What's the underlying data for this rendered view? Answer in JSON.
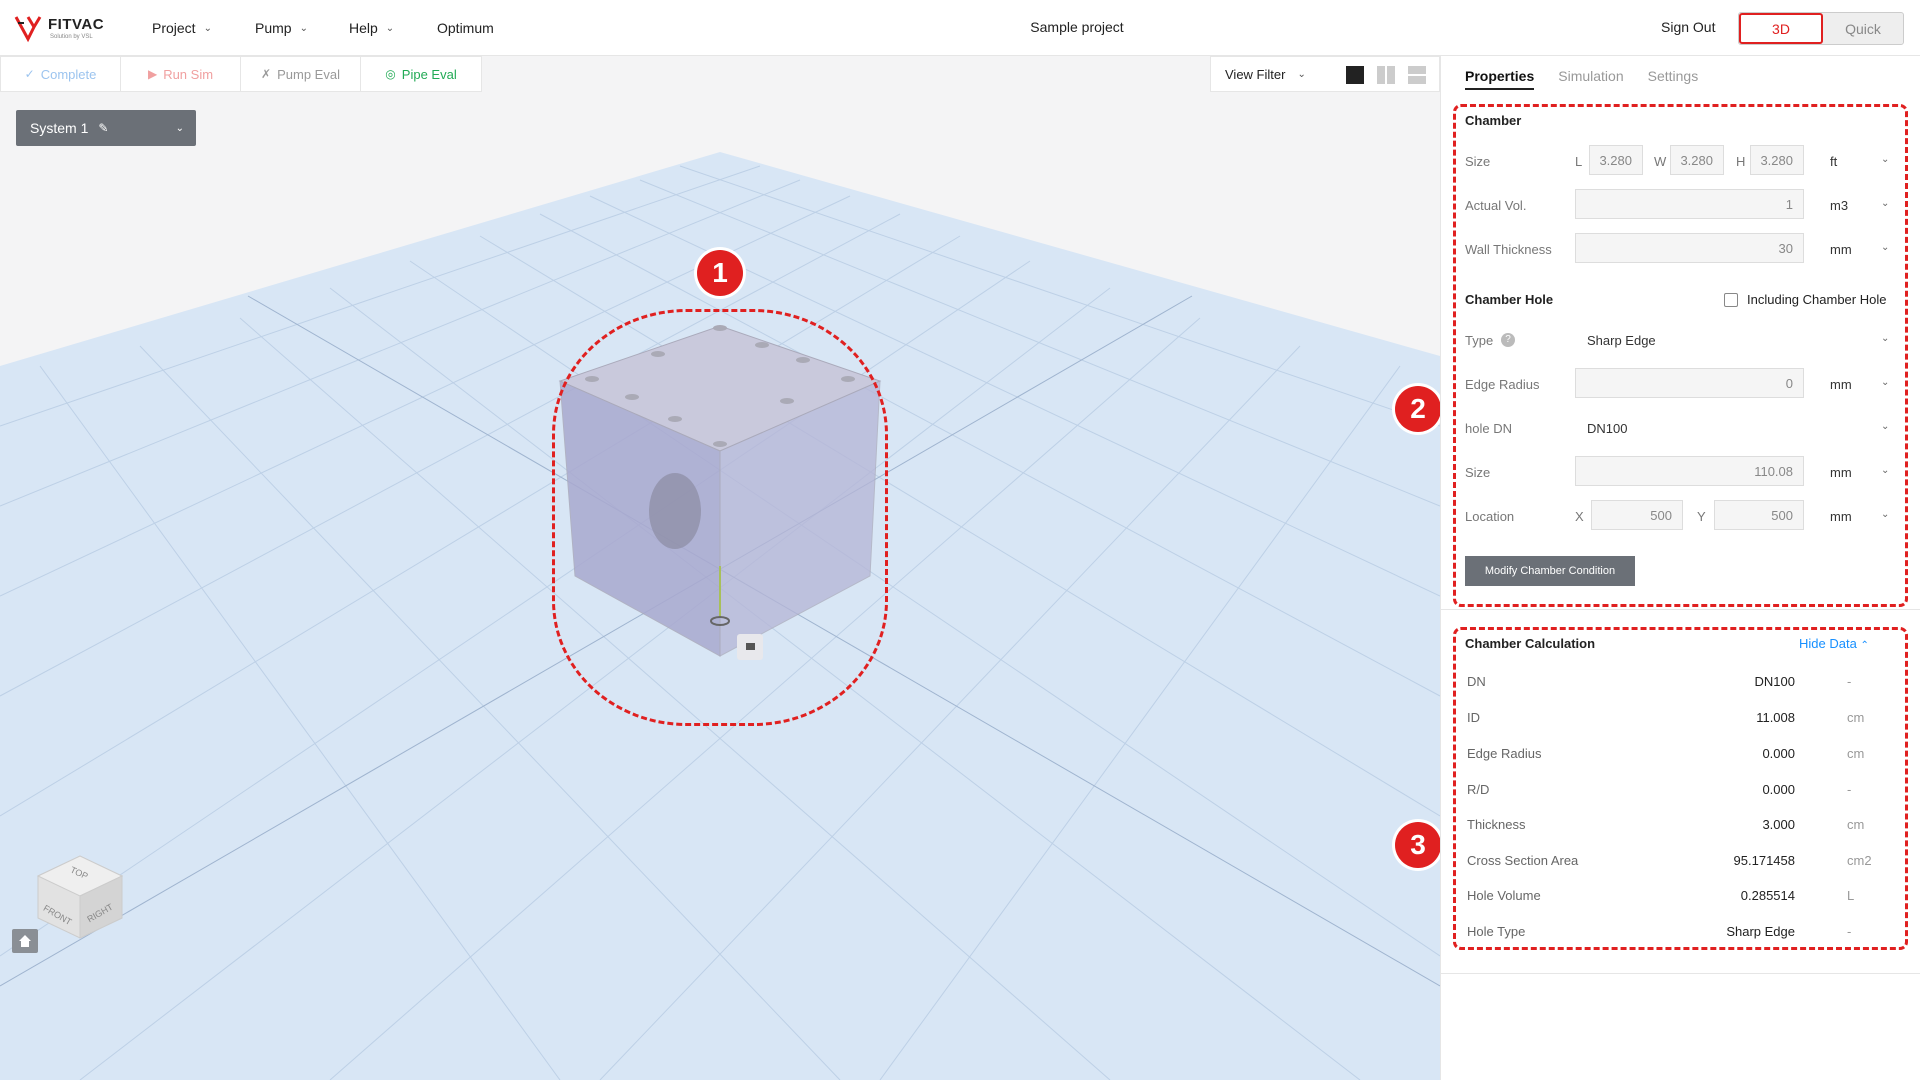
{
  "header": {
    "logo_text": "FITVAC",
    "logo_sub": "Solution by VSL",
    "menu": [
      {
        "label": "Project"
      },
      {
        "label": "Pump"
      },
      {
        "label": "Help"
      },
      {
        "label": "Optimum"
      }
    ],
    "project_title": "Sample project",
    "sign_out": "Sign Out",
    "view_mode": {
      "active": "3D",
      "inactive": "Quick"
    }
  },
  "toolbar": {
    "complete": "Complete",
    "run_sim": "Run Sim",
    "pump_eval": "Pump Eval",
    "pipe_eval": "Pipe Eval",
    "view_filter": "View Filter"
  },
  "system_selector": {
    "label": "System 1"
  },
  "viewport": {
    "cube_labels": {
      "top": "TOP",
      "front": "FRONT",
      "right": "RIGHT"
    },
    "badges": [
      "1",
      "2",
      "3"
    ]
  },
  "panel": {
    "tabs": [
      "Properties",
      "Simulation",
      "Settings"
    ],
    "chamber": {
      "title": "Chamber",
      "size_label": "Size",
      "size_L_label": "L",
      "size_L": "3.280",
      "size_W_label": "W",
      "size_W": "3.280",
      "size_H_label": "H",
      "size_H": "3.280",
      "size_unit": "ft",
      "actual_vol_label": "Actual Vol.",
      "actual_vol": "1",
      "actual_vol_unit": "m3",
      "wall_label": "Wall Thickness",
      "wall": "30",
      "wall_unit": "mm"
    },
    "hole": {
      "title": "Chamber Hole",
      "include_label": "Including Chamber Hole",
      "type_label": "Type",
      "type_value": "Sharp Edge",
      "edge_label": "Edge Radius",
      "edge_value": "0",
      "edge_unit": "mm",
      "dn_label": "hole DN",
      "dn_value": "DN100",
      "size_label": "Size",
      "size_value": "110.08",
      "size_unit": "mm",
      "loc_label": "Location",
      "loc_x_label": "X",
      "loc_x": "500",
      "loc_y_label": "Y",
      "loc_y": "500",
      "loc_unit": "mm",
      "modify_button": "Modify Chamber Condition"
    },
    "calc": {
      "title": "Chamber Calculation",
      "hide_label": "Hide Data",
      "rows": [
        {
          "k": "DN",
          "v": "DN100",
          "u": "-"
        },
        {
          "k": "ID",
          "v": "11.008",
          "u": "cm"
        },
        {
          "k": "Edge Radius",
          "v": "0.000",
          "u": "cm"
        },
        {
          "k": "R/D",
          "v": "0.000",
          "u": "-"
        },
        {
          "k": "Thickness",
          "v": "3.000",
          "u": "cm"
        },
        {
          "k": "Cross Section Area",
          "v": "95.171458",
          "u": "cm2"
        },
        {
          "k": "Hole Volume",
          "v": "0.285514",
          "u": "L"
        },
        {
          "k": "Hole Type",
          "v": "Sharp Edge",
          "u": "-"
        }
      ]
    }
  },
  "colors": {
    "accent": "#e02020",
    "link": "#1890ff",
    "green": "#22aa55",
    "viewport_floor": "#d8e6f5"
  }
}
